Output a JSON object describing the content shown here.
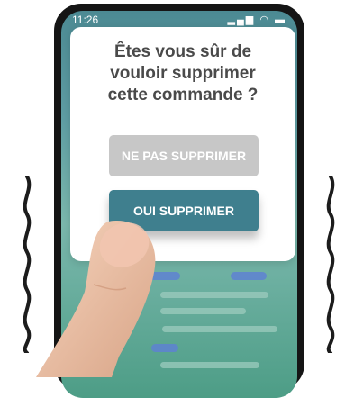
{
  "status_bar": {
    "time": "11:26"
  },
  "dialog": {
    "title": "Êtes vous sûr de\nvouloir supprimer\ncette commande ?",
    "cancel_label": "NE PAS SUPPRIMER",
    "confirm_label": "OUI SUPPRIMER"
  },
  "colors": {
    "confirm_button": "#3f7f8e",
    "cancel_button": "#c7c7c7",
    "screen_top": "#4c8a93",
    "screen_bottom": "#4d9d86"
  },
  "icons": [
    "signal-icon",
    "wifi-icon",
    "battery-icon",
    "vibration-icon",
    "finger-illustration"
  ]
}
